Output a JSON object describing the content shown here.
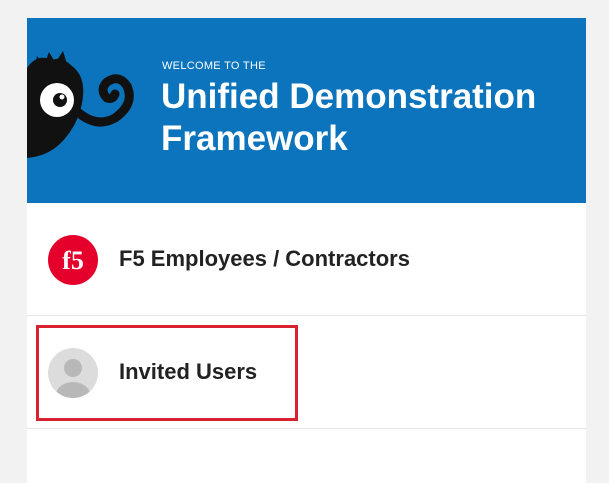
{
  "hero": {
    "welcome": "WELCOME TO THE",
    "title": "Unified Demonstration Framework",
    "background_color": "#0b74bd",
    "mascot_icon": "octopus-mascot-icon"
  },
  "login_options": [
    {
      "label": "F5 Employees / Contractors",
      "icon": "f5-logo-icon",
      "icon_color": "#e4002b"
    },
    {
      "label": "Invited Users",
      "icon": "user-avatar-icon",
      "highlighted": true
    }
  ],
  "colors": {
    "highlight_border": "#d8222f",
    "page_background": "#f2f2f2"
  }
}
